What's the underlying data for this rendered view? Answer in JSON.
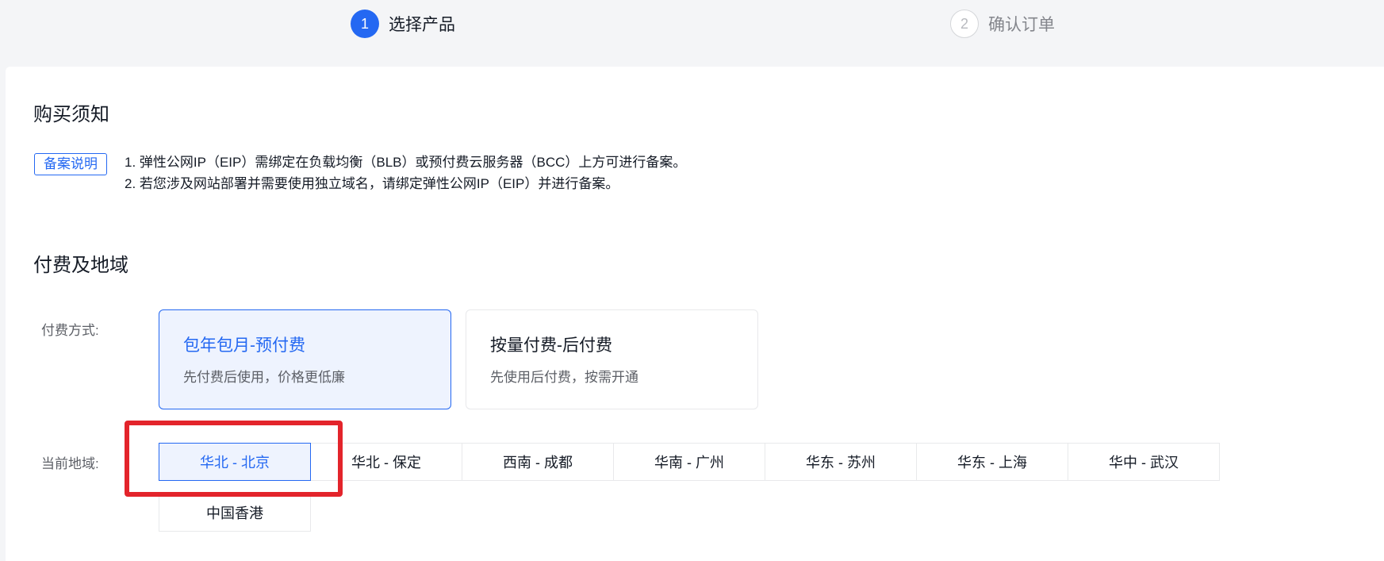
{
  "steps": [
    {
      "number": "1",
      "label": "选择产品"
    },
    {
      "number": "2",
      "label": "确认订单"
    }
  ],
  "notice": {
    "title": "购买须知",
    "tag": "备案说明",
    "lines": [
      "1. 弹性公网IP（EIP）需绑定在负载均衡（BLB）或预付费云服务器（BCC）上方可进行备案。",
      "2. 若您涉及网站部署并需要使用独立域名，请绑定弹性公网IP（EIP）并进行备案。"
    ]
  },
  "billing": {
    "title": "付费及地域",
    "method_label": "付费方式:",
    "options": [
      {
        "title": "包年包月-预付费",
        "desc": "先付费后使用，价格更低廉",
        "selected": true
      },
      {
        "title": "按量付费-后付费",
        "desc": "先使用后付费，按需开通",
        "selected": false
      }
    ],
    "region_label": "当前地域:",
    "regions": [
      "华北 - 北京",
      "华北 - 保定",
      "西南 - 成都",
      "华南 - 广州",
      "华东 - 苏州",
      "华东 - 上海",
      "华中 - 武汉",
      "中国香港"
    ],
    "selected_region": "华北 - 北京"
  },
  "colors": {
    "accent": "#2468f2",
    "highlight": "#e3242b"
  }
}
